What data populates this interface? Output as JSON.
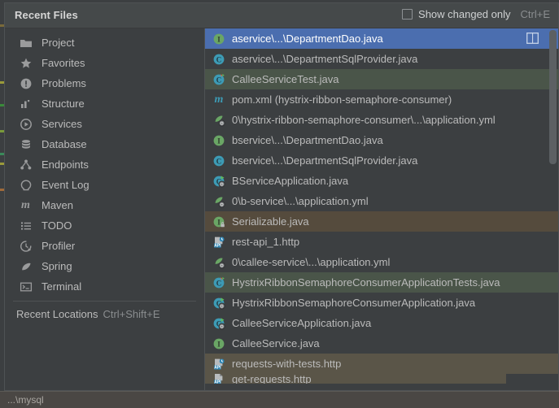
{
  "window": {
    "title": "Recent Files",
    "status_text": "...\\mysql"
  },
  "header": {
    "title": "Recent Files",
    "checkbox_label": "Show changed only",
    "checkbox_shortcut": "Ctrl+E",
    "checkbox_checked": false
  },
  "sidebar": {
    "items": [
      {
        "label": "Project",
        "icon": "folder-icon"
      },
      {
        "label": "Favorites",
        "icon": "star-icon"
      },
      {
        "label": "Problems",
        "icon": "problems-icon"
      },
      {
        "label": "Structure",
        "icon": "structure-icon"
      },
      {
        "label": "Services",
        "icon": "services-play-icon"
      },
      {
        "label": "Database",
        "icon": "database-icon"
      },
      {
        "label": "Endpoints",
        "icon": "endpoints-icon"
      },
      {
        "label": "Event Log",
        "icon": "event-log-icon"
      },
      {
        "label": "Maven",
        "icon": "maven-m-icon"
      },
      {
        "label": "TODO",
        "icon": "todo-list-icon"
      },
      {
        "label": "Profiler",
        "icon": "profiler-clock-icon"
      },
      {
        "label": "Spring",
        "icon": "spring-leaf-icon"
      },
      {
        "label": "Terminal",
        "icon": "terminal-icon"
      }
    ],
    "footer": {
      "label": "Recent Locations",
      "shortcut": "Ctrl+Shift+E"
    }
  },
  "files": {
    "rows": [
      {
        "name": "aservice\\...\\DepartmentDao.java",
        "icon": "java-interface-icon",
        "state": "sel",
        "action_icon": "split-vertically-icon"
      },
      {
        "name": "aservice\\...\\DepartmentSqlProvider.java",
        "icon": "java-class-icon",
        "state": "normal"
      },
      {
        "name": "CalleeServiceTest.java",
        "icon": "java-test-class-icon",
        "state": "green"
      },
      {
        "name": "pom.xml (hystrix-ribbon-semaphore-consumer)",
        "icon": "maven-pom-icon",
        "state": "normal"
      },
      {
        "name": "0\\hystrix-ribbon-semaphore-consumer\\...\\application.yml",
        "icon": "spring-yaml-icon",
        "state": "normal"
      },
      {
        "name": "bservice\\...\\DepartmentDao.java",
        "icon": "java-interface-icon",
        "state": "normal"
      },
      {
        "name": "bservice\\...\\DepartmentSqlProvider.java",
        "icon": "java-class-icon",
        "state": "normal"
      },
      {
        "name": "BServiceApplication.java",
        "icon": "spring-boot-class-icon",
        "state": "normal"
      },
      {
        "name": "0\\b-service\\...\\application.yml",
        "icon": "spring-yaml-icon",
        "state": "normal"
      },
      {
        "name": "Serializable.java",
        "icon": "java-interface-locked-icon",
        "state": "brown"
      },
      {
        "name": "rest-api_1.http",
        "icon": "http-api-file-icon",
        "state": "normal"
      },
      {
        "name": "0\\callee-service\\...\\application.yml",
        "icon": "spring-yaml-icon",
        "state": "normal"
      },
      {
        "name": "HystrixRibbonSemaphoreConsumerApplicationTests.java",
        "icon": "java-test-class-icon",
        "state": "green"
      },
      {
        "name": "HystrixRibbonSemaphoreConsumerApplication.java",
        "icon": "spring-boot-class-icon",
        "state": "normal"
      },
      {
        "name": "CalleeServiceApplication.java",
        "icon": "spring-boot-class-icon",
        "state": "normal"
      },
      {
        "name": "CalleeService.java",
        "icon": "java-interface-icon",
        "state": "normal"
      },
      {
        "name": "requests-with-tests.http",
        "icon": "http-api-file-icon",
        "state": "brown2"
      },
      {
        "name": "get-requests.http",
        "icon": "http-file-icon",
        "state": "brown2"
      }
    ]
  },
  "colors": {
    "popup_bg": "#3c3f41",
    "header_bg": "#45494a",
    "selection_blue": "#4b6eaf",
    "green_row": "#4a5549",
    "brown_row": "#554b3d",
    "text": "#bbbbbb",
    "statusbar_bg": "#4a4744"
  }
}
